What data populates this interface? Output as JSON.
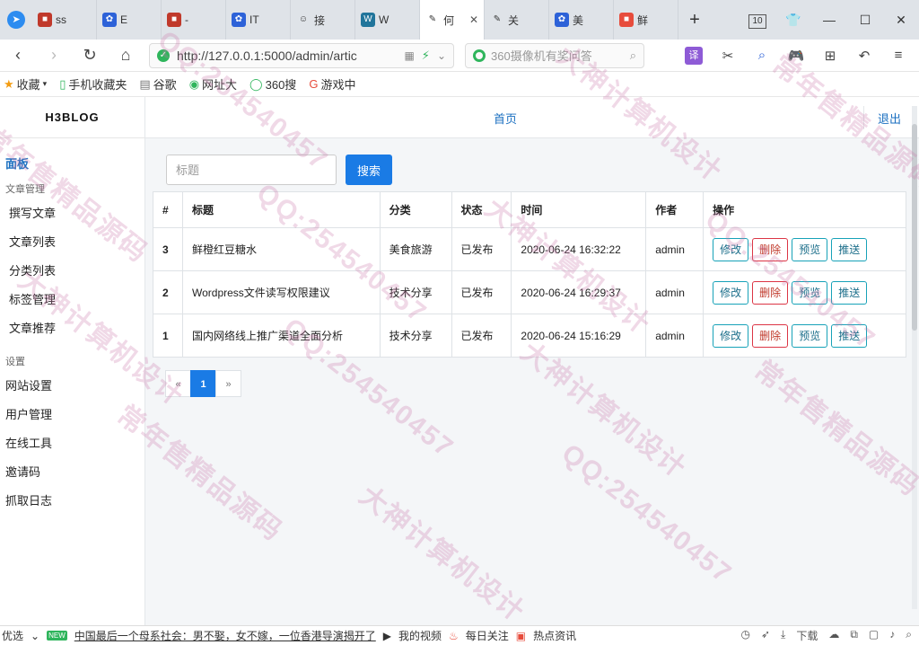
{
  "browser": {
    "nav_toggle_icon": "navigation-icon",
    "tabs": [
      {
        "title": "ss",
        "icon": "site-favicon",
        "color": "#c0392b"
      },
      {
        "title": "E",
        "icon": "baidu-paw-icon",
        "color": "#2d62d8"
      },
      {
        "title": "-",
        "icon": "site-favicon",
        "color": "#c0392b"
      },
      {
        "title": "IT",
        "icon": "baidu-paw-icon",
        "color": "#2d62d8"
      },
      {
        "title": "接",
        "icon": "avatar-icon",
        "color": "#333333"
      },
      {
        "title": "W",
        "icon": "wordpress-icon",
        "color": "#21759b"
      },
      {
        "title": "何",
        "icon": "edit-icon",
        "color": "#333333",
        "active": true
      },
      {
        "title": "关",
        "icon": "edit-icon",
        "color": "#333333"
      },
      {
        "title": "美",
        "icon": "baidu-paw-icon",
        "color": "#2d62d8"
      },
      {
        "title": "鲜",
        "icon": "site-favicon",
        "color": "#e74c3c"
      }
    ],
    "new_tab": "+",
    "tab_count": "10",
    "url": "http://127.0.0.1:5000/admin/artic",
    "search_placeholder": "360摄像机有奖问答",
    "translate_label": "译",
    "bookmarks": [
      {
        "label": "收藏",
        "icon": "star-icon"
      },
      {
        "label": "手机收藏夹",
        "icon": "phone-icon"
      },
      {
        "label": "谷歌",
        "icon": "page-icon"
      },
      {
        "label": "网址大",
        "icon": "site-icon"
      },
      {
        "label": "360搜",
        "icon": "so-icon"
      },
      {
        "label": "游戏中",
        "icon": "game-icon"
      }
    ],
    "status": {
      "left": "优选",
      "new_badge": "NEW",
      "news": "中国最后一个母系社会：男不娶，女不嫁，一位香港导演揭开了",
      "items": [
        "我的视频",
        "每日关注",
        "热点资讯"
      ],
      "download": "下载"
    }
  },
  "app": {
    "brand": "H3BLOG",
    "sidebar": {
      "home": "面板",
      "groups": [
        {
          "title": "文章管理",
          "items": [
            "撰写文章",
            "文章列表",
            "分类列表",
            "标签管理",
            "文章推荐"
          ]
        },
        {
          "title": "设置",
          "items": [
            "网站设置",
            "用户管理",
            "在线工具",
            "邀请码",
            "抓取日志"
          ]
        }
      ]
    },
    "header": {
      "home": "首页",
      "logout": "退出"
    },
    "search": {
      "placeholder": "标题",
      "button": "搜索"
    },
    "table": {
      "columns": [
        "#",
        "标题",
        "分类",
        "状态",
        "时间",
        "作者",
        "操作"
      ],
      "rows": [
        {
          "id": "3",
          "title": "鲜橙红豆糖水",
          "category": "美食旅游",
          "status": "已发布",
          "time": "2020-06-24 16:32:22",
          "author": "admin"
        },
        {
          "id": "2",
          "title": "Wordpress文件读写权限建议",
          "category": "技术分享",
          "status": "已发布",
          "time": "2020-06-24 16:29:37",
          "author": "admin"
        },
        {
          "id": "1",
          "title": "国内网络线上推广渠道全面分析",
          "category": "技术分享",
          "status": "已发布",
          "time": "2020-06-24 15:16:29",
          "author": "admin"
        }
      ],
      "actions": {
        "edit": "修改",
        "delete": "删除",
        "preview": "预览",
        "push": "推送"
      }
    },
    "pagination": {
      "prev": "«",
      "current": "1",
      "next": "»"
    }
  },
  "watermark": {
    "lines": [
      "QQ:254540457",
      "大神计算机设计",
      "常年售精品源码"
    ],
    "color": "#c878aa"
  }
}
